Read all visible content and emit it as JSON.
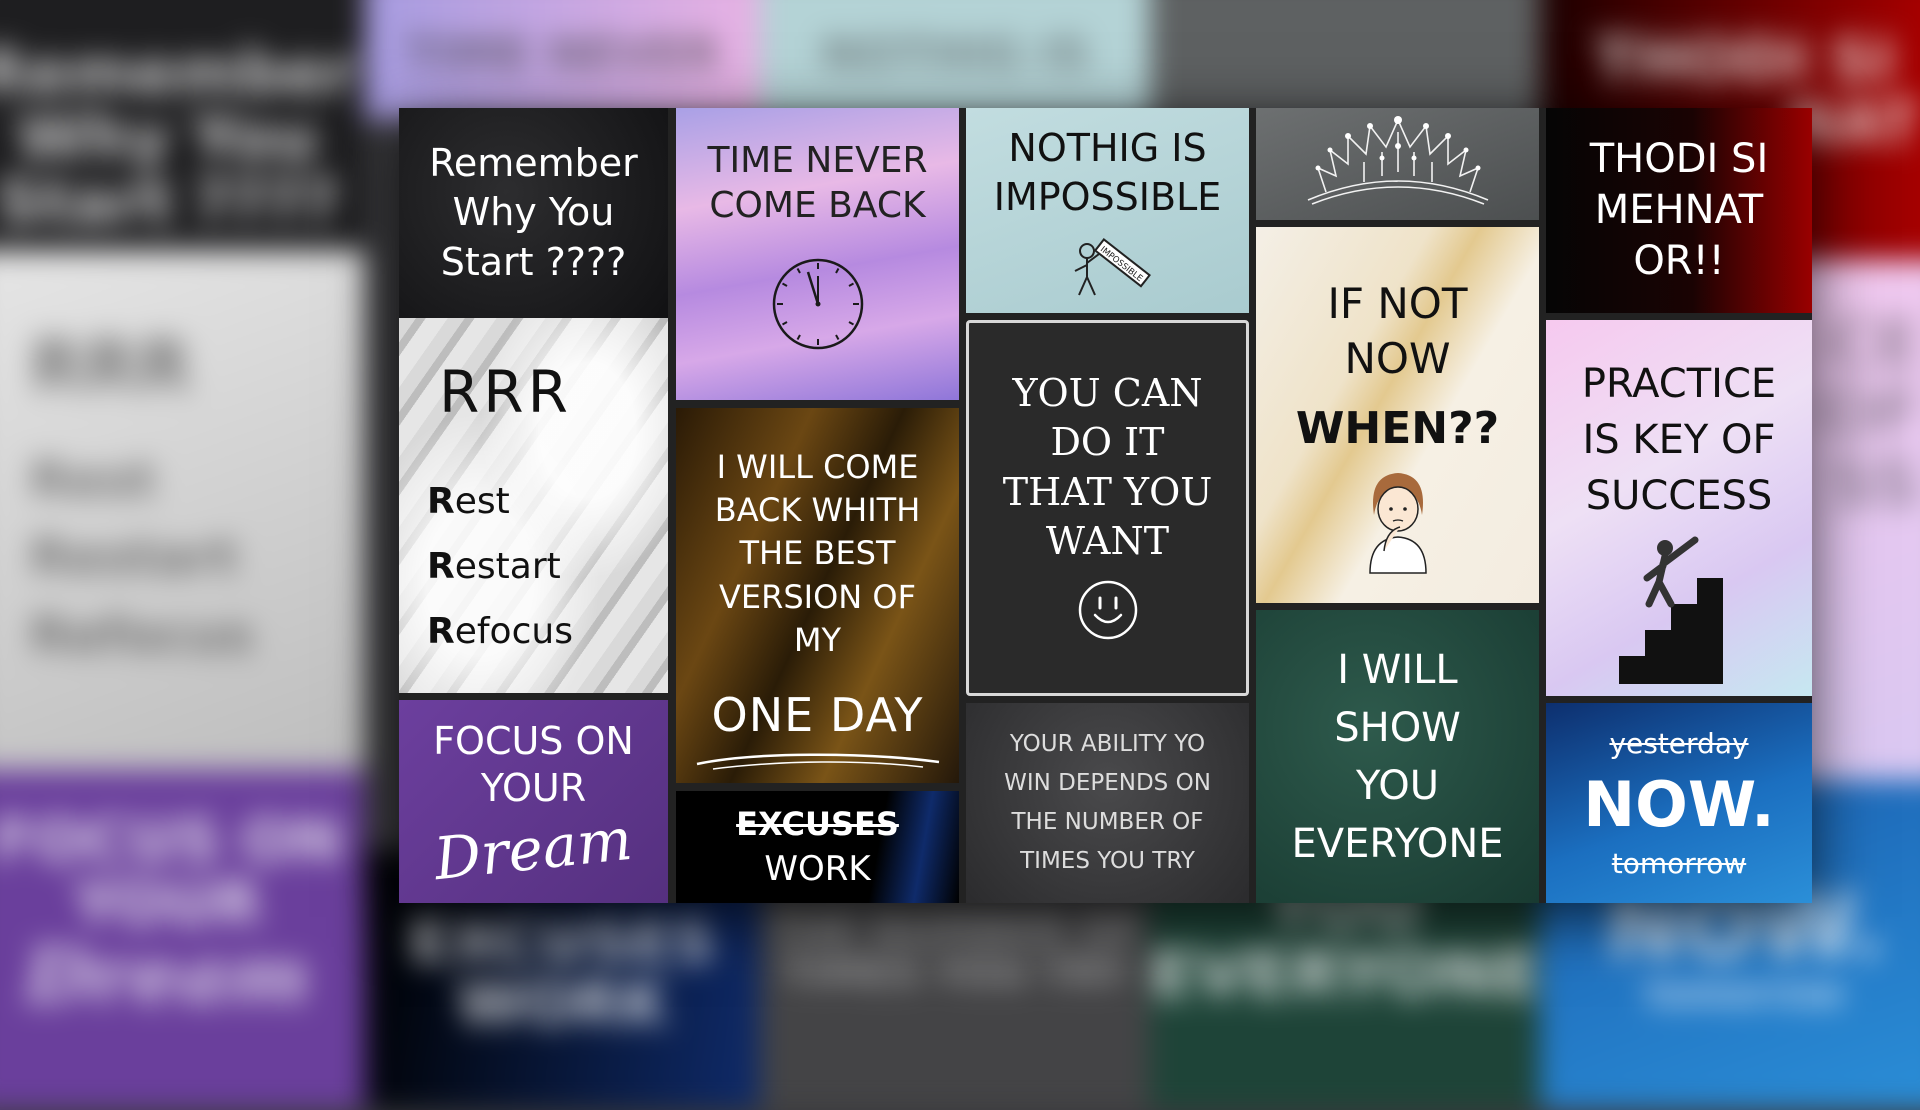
{
  "background": {
    "tiles": [
      {
        "lines": [
          "Remember",
          "Why You",
          "Start ????"
        ]
      },
      {
        "lines": [
          "TIME NEVER"
        ]
      },
      {
        "lines": [
          "NOTHIG IS"
        ]
      },
      {
        "lines": []
      },
      {
        "lines": [
          "THODI SI",
          "NAT"
        ]
      },
      {
        "lines": [
          "RRR",
          "Rest",
          "Restart",
          "Refocus"
        ]
      },
      {
        "lines": [
          "CE",
          "OF",
          "SS"
        ]
      },
      {
        "lines": [
          "FOCUS ON",
          "YOUR",
          "Dream"
        ]
      },
      {
        "lines": [
          "EXCUSES",
          "WORK"
        ]
      },
      {
        "lines": [
          "THE NUMBER OF",
          "TIMES YOU TRY"
        ]
      },
      {
        "lines": [
          "YOU",
          "EVERYONE"
        ]
      },
      {
        "lines": [
          "NOW.",
          "tomorrow"
        ]
      }
    ]
  },
  "tiles": {
    "remember": {
      "lines": [
        "Remember",
        "Why You",
        "Start ????"
      ]
    },
    "rrr": {
      "title": "RRR",
      "items": [
        {
          "initial": "R",
          "rest": "est"
        },
        {
          "initial": "R",
          "rest": "estart"
        },
        {
          "initial": "R",
          "rest": "efocus"
        }
      ]
    },
    "focus": {
      "line1": "FOCUS ON",
      "line2": "YOUR",
      "script": "Dream"
    },
    "time": {
      "line1": "TIME NEVER",
      "line2": "COME BACK"
    },
    "willcome": {
      "lines": [
        "I WILL COME",
        "BACK WHITH",
        "THE BEST",
        "VERSION OF",
        "MY"
      ],
      "big": "ONE DAY"
    },
    "excuses": {
      "strike": "EXCUSES",
      "word": "WORK"
    },
    "nothing": {
      "line1": "NOTHIG IS",
      "line2": "IMPOSSIBLE",
      "sign": "IMPOSSIBLE"
    },
    "youcan": {
      "lines": [
        "YOU CAN",
        "DO IT",
        "THAT YOU",
        "WANT"
      ]
    },
    "ability": {
      "lines": [
        "YOUR ABILITY YO",
        "WIN DEPENDS ON",
        "THE NUMBER OF",
        "TIMES YOU TRY"
      ]
    },
    "ifnot": {
      "line1": "IF NOT",
      "line2": "NOW",
      "bold": "WHEN??"
    },
    "iwill": {
      "lines": [
        "I WILL",
        "SHOW",
        "YOU",
        "EVERYONE"
      ]
    },
    "thodi": {
      "lines": [
        "THODI SI",
        "MEHNAT",
        "OR!!"
      ]
    },
    "practice": {
      "lines": [
        "PRACTICE",
        "IS KEY OF",
        "SUCCESS"
      ]
    },
    "now": {
      "top": "yesterday",
      "big": "NOW.",
      "bottom": "tomorrow"
    }
  },
  "icons": [
    "clock-icon",
    "crown-icon",
    "smiley-icon",
    "girl-thinking-icon",
    "stairs-climber-icon",
    "man-carrying-sign-icon"
  ]
}
